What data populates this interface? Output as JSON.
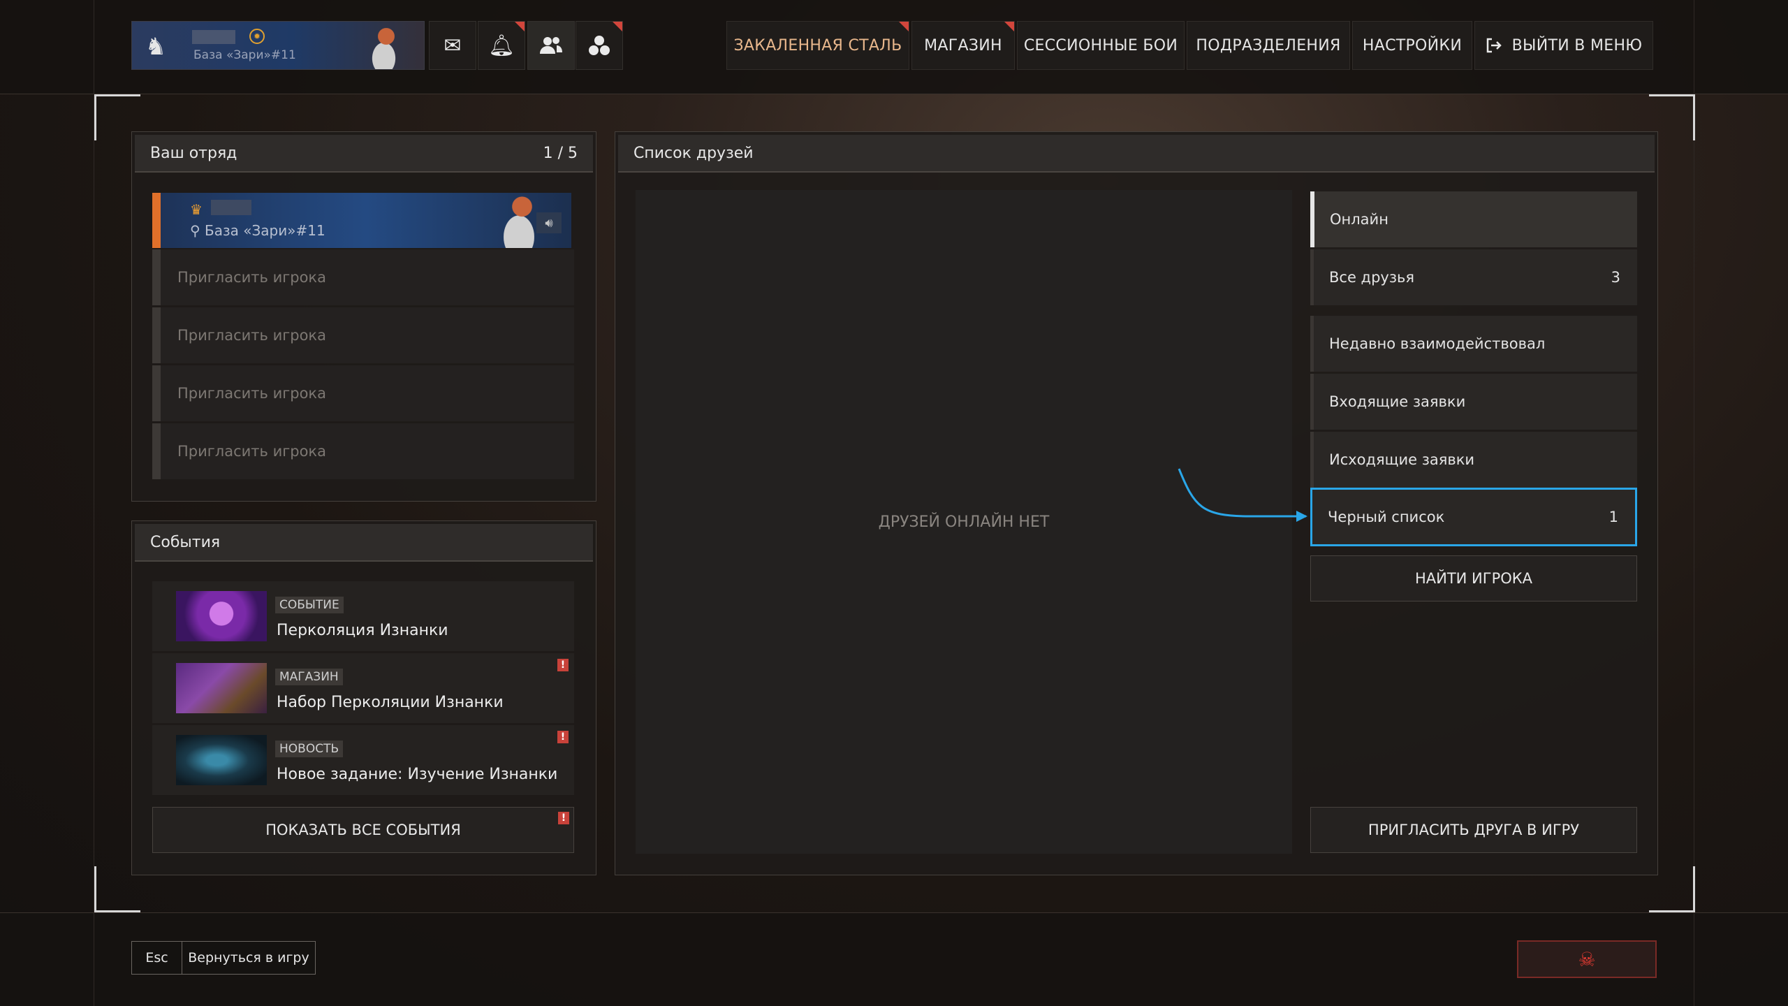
{
  "profile": {
    "base_label": "База «Зари»#11",
    "logo_icon": "wolf-logo-icon",
    "currency_icon": "coin-icon"
  },
  "header_icons": [
    "mail-icon",
    "bell-icon",
    "friends-icon",
    "units-icon"
  ],
  "nav": {
    "hardened_steel": "ЗАКАЛЕННАЯ СТАЛЬ",
    "shop": "МАГАЗИН",
    "session_battles": "СЕССИОННЫЕ БОИ",
    "units": "ПОДРАЗДЕЛЕНИЯ",
    "settings": "НАСТРОЙКИ",
    "exit": "ВЫЙТИ В МЕНЮ"
  },
  "squad": {
    "title": "Ваш отряд",
    "count": "1 / 5",
    "leader_base": "База «Зари»#11",
    "invite_slots": [
      "Пригласить игрока",
      "Пригласить игрока",
      "Пригласить игрока",
      "Пригласить игрока"
    ]
  },
  "events": {
    "title": "События",
    "items": [
      {
        "tag": "СОБЫТИЕ",
        "title": "Перколяция Изнанки",
        "alert": false
      },
      {
        "tag": "МАГАЗИН",
        "title": "Набор Перколяции Изнанки",
        "alert": true
      },
      {
        "tag": "НОВОСТЬ",
        "title": "Новое задание: Изучение Изнанки",
        "alert": true
      }
    ],
    "show_all": "ПОКАЗАТЬ ВСЕ СОБЫТИЯ"
  },
  "friends": {
    "title": "Список друзей",
    "empty": "ДРУЗЕЙ ОНЛАЙН НЕТ",
    "filters": {
      "online": "Онлайн",
      "all": "Все друзья",
      "all_count": "3",
      "recent": "Недавно взаимодействовал",
      "incoming": "Входящие заявки",
      "outgoing": "Исходящие заявки",
      "blacklist": "Черный список",
      "blacklist_count": "1"
    },
    "find_player": "НАЙТИ ИГРОКА",
    "invite_friend": "ПРИГЛАСИТЬ ДРУГА В ИГРУ"
  },
  "footer": {
    "esc_key": "Esc",
    "back_label": "Вернуться в игру",
    "report_icon": "skull-icon"
  },
  "colors": {
    "accent_orange": "#e0702a",
    "highlight_blue": "#2aa6e8",
    "alert_red": "#c8423a"
  }
}
